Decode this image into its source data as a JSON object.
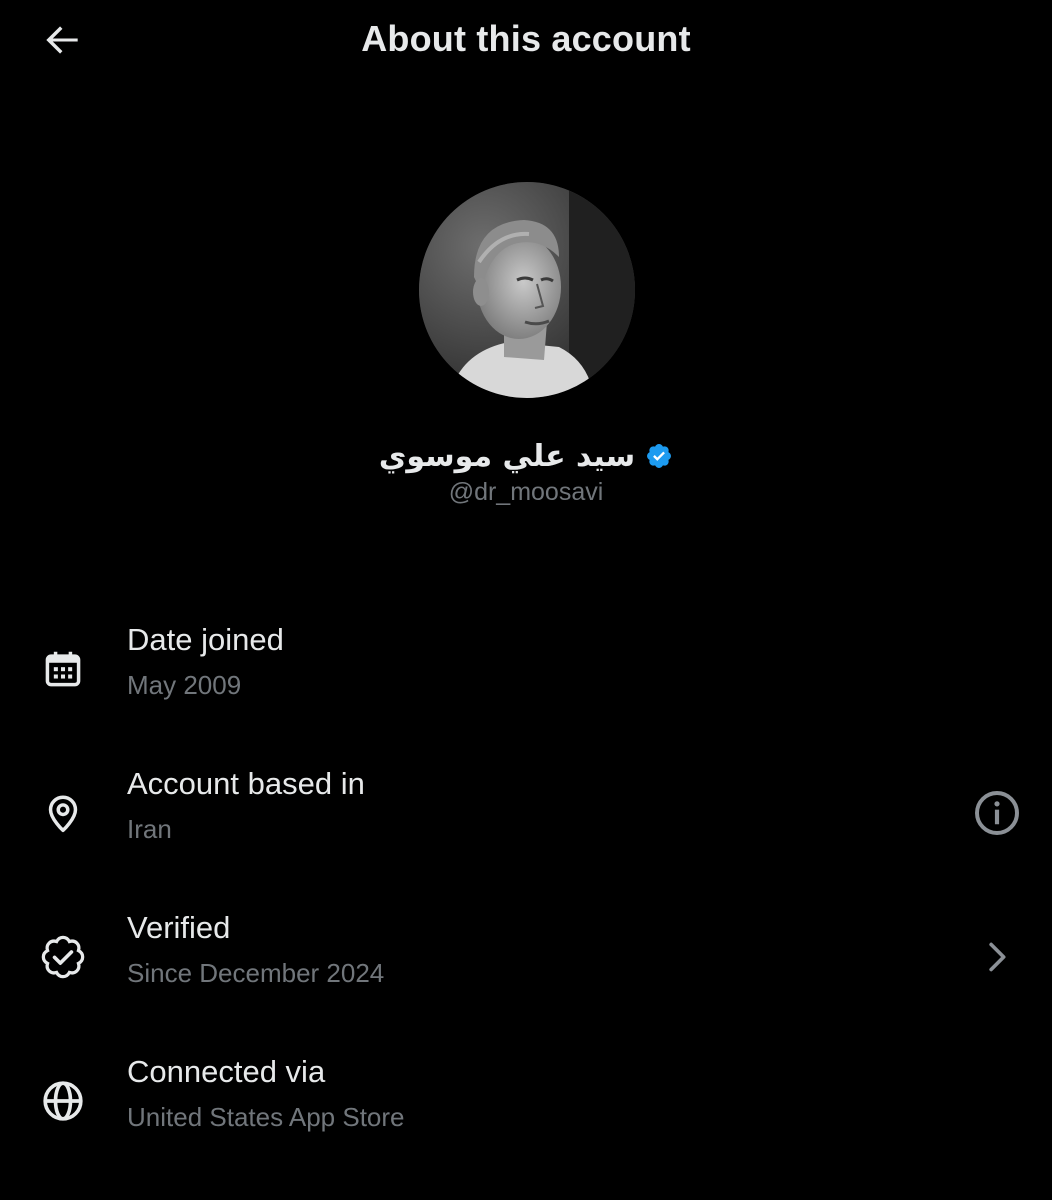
{
  "header": {
    "title": "About this account",
    "back_icon": "arrow-left-icon"
  },
  "profile": {
    "display_name": "سيد علي موسوي",
    "handle": "@dr_moosavi",
    "verified": true,
    "badge_color": "#1d9bf0"
  },
  "rows": [
    {
      "label": "Date joined",
      "value": "May 2009",
      "icon": "calendar-icon"
    },
    {
      "label": "Account based in",
      "value": "Iran",
      "icon": "location-pin-icon",
      "action_icon": "info-icon"
    },
    {
      "label": "Verified",
      "value": "Since December 2024",
      "icon": "verified-badge-outline-icon",
      "action_icon": "chevron-right-icon"
    },
    {
      "label": "Connected via",
      "value": "United States App Store",
      "icon": "globe-icon"
    }
  ],
  "colors": {
    "background": "#000000",
    "primary_text": "#e7e9ea",
    "secondary_text": "#71767b",
    "accent": "#1d9bf0"
  }
}
